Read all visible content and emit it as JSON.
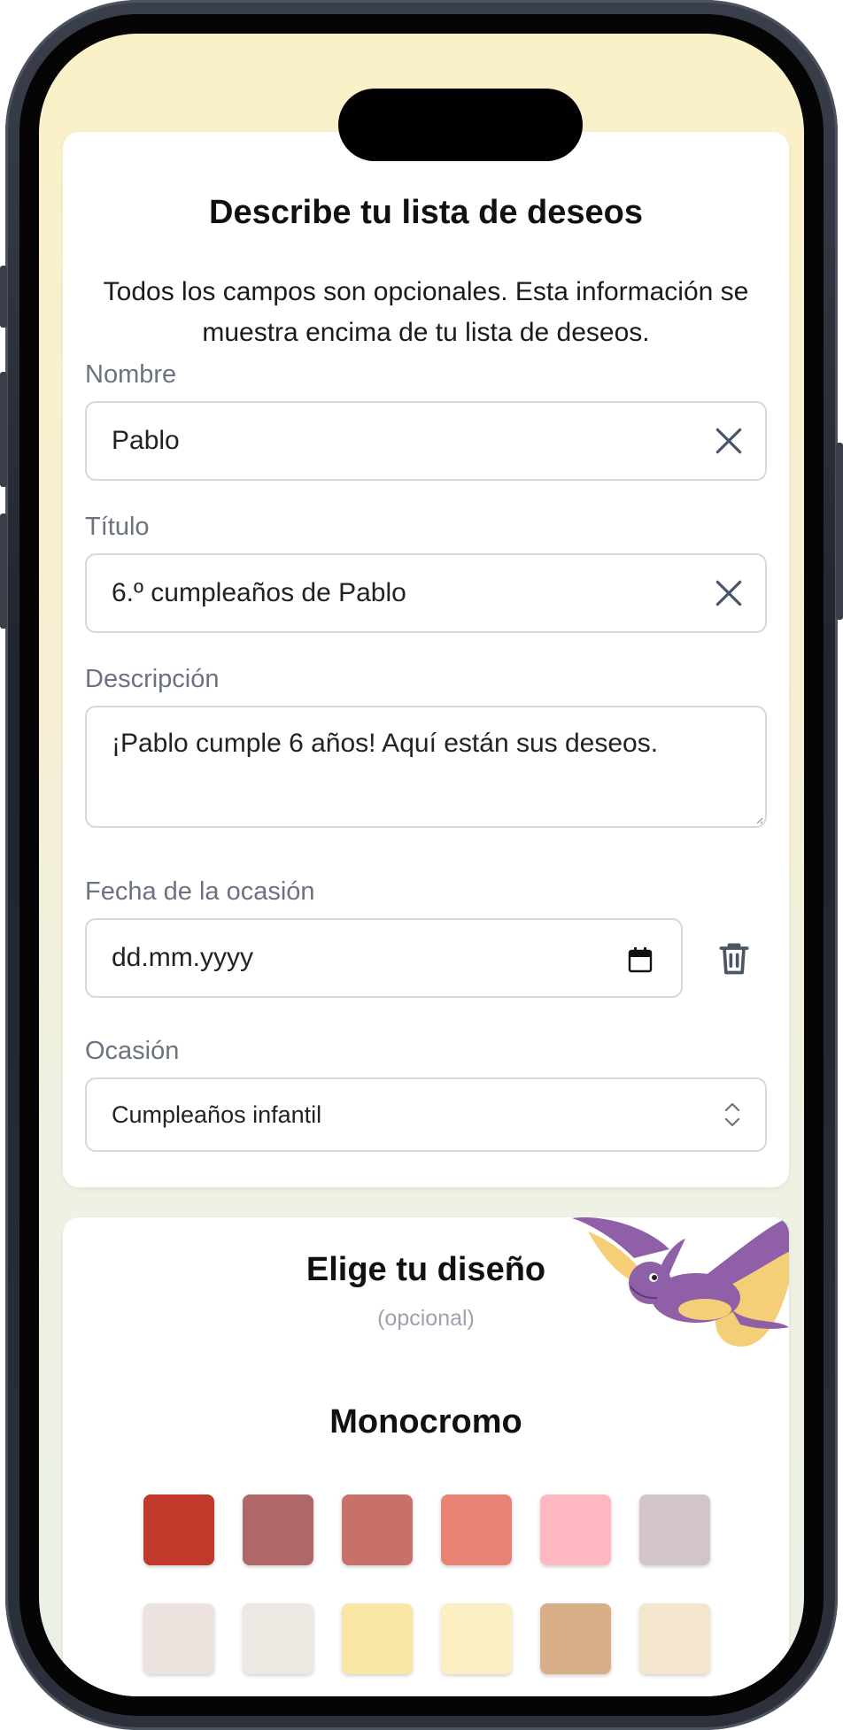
{
  "form": {
    "title": "Describe tu lista de deseos",
    "intro": "Todos los campos son opcionales. Esta información se muestra encima de tu lista de deseos.",
    "name_label": "Nombre",
    "name_value": "Pablo",
    "title_label": "Título",
    "title_value": "6.º cumpleaños de Pablo",
    "description_label": "Descripción",
    "description_value": "¡Pablo cumple 6 años! Aquí están sus deseos.",
    "date_label": "Fecha de la ocasión",
    "date_placeholder": "dd.mm.yyyy",
    "occasion_label": "Ocasión",
    "occasion_value": "Cumpleaños infantil"
  },
  "design": {
    "title": "Elige tu diseño",
    "subtitle": "(opcional)",
    "section_title": "Monocromo",
    "swatches_row1": [
      "#c0392b",
      "#b06767",
      "#c8716b",
      "#e88274",
      "#ffb7c0",
      "#d2c4c8"
    ],
    "swatches_row2": [
      "#ece2de",
      "#ece8e2",
      "#fae6a4",
      "#fcefc3",
      "#d9af89",
      "#f4e6cc"
    ]
  },
  "icons": {
    "clear": "close-x-icon",
    "calendar": "calendar-icon",
    "trash": "trash-icon",
    "select": "chevron-up-down-icon"
  }
}
